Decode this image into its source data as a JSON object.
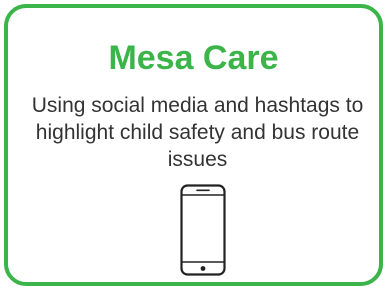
{
  "card": {
    "title": "Mesa Care",
    "description": "Using social media and hashtags to highlight child safety and bus route issues",
    "icon": "smartphone-icon"
  },
  "colors": {
    "accent": "#3bb54a",
    "text": "#333333",
    "background": "#ffffff"
  }
}
